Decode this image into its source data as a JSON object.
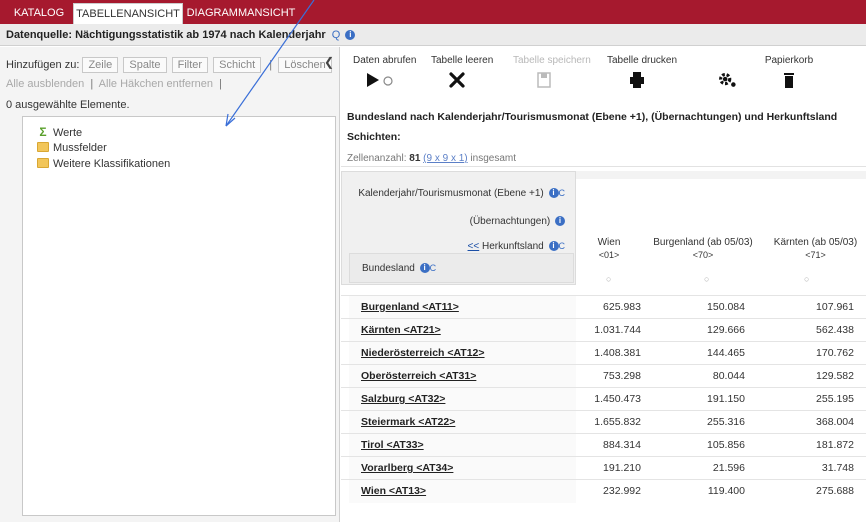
{
  "tabs": [
    {
      "label": "KATALOG"
    },
    {
      "label": "TABELLENANSICHT"
    },
    {
      "label": "DIAGRAMMANSICHT"
    }
  ],
  "source": {
    "text": "Datenquelle: Nächtigungsstatistik ab 1974 nach Kalenderjahr",
    "q_label": "Q"
  },
  "left": {
    "add_label": "Hinzufügen zu:",
    "add_buttons": [
      "Zeile",
      "Spalte",
      "Filter",
      "Schicht"
    ],
    "delete_label": "Löschen",
    "hide_all": "Alle ausblenden",
    "remove_checks": "Alle Häkchen entfernen",
    "selected_count": "0 ausgewählte Elemente.",
    "tree": [
      "Werte",
      "Mussfelder",
      "Weitere Klassifikationen"
    ]
  },
  "toolbar": {
    "fetch": "Daten abrufen",
    "clear": "Tabelle leeren",
    "save": "Tabelle speichern",
    "print": "Tabelle drucken",
    "trash": "Papierkorb"
  },
  "table": {
    "title": "Bundesland nach Kalenderjahr/Tourismusmonat (Ebene +1), (Übernachtungen) und Herkunftsland",
    "layers_label": "Schichten:",
    "cellcount_prefix": "Zellenanzahl:",
    "cellcount_value": "81",
    "cellcount_formula": "(9 x 9 x 1)",
    "cellcount_suffix": "insgesamt",
    "hdr_kalender": "Kalenderjahr/Tourismusmonat (Ebene +1)",
    "hdr_uebernachtungen": "(Übernachtungen)",
    "hdr_herkunft_prefix": "<<",
    "hdr_herkunft": "Herkunftsland",
    "hdr_bundesland": "Bundesland",
    "columns": [
      {
        "name": "Wien",
        "code": "<01>"
      },
      {
        "name": "Burgenland (ab 05/03)",
        "code": "<70>"
      },
      {
        "name": "Kärnten (ab 05/03)",
        "code": "<71>"
      }
    ],
    "rows": [
      {
        "name": "Burgenland <AT11>",
        "v": [
          "625.983",
          "150.084",
          "107.961"
        ]
      },
      {
        "name": "Kärnten <AT21>",
        "v": [
          "1.031.744",
          "129.666",
          "562.438"
        ]
      },
      {
        "name": "Niederösterreich <AT12>",
        "v": [
          "1.408.381",
          "144.465",
          "170.762"
        ]
      },
      {
        "name": "Oberösterreich <AT31>",
        "v": [
          "753.298",
          "80.044",
          "129.582"
        ]
      },
      {
        "name": "Salzburg <AT32>",
        "v": [
          "1.450.473",
          "191.150",
          "255.195"
        ]
      },
      {
        "name": "Steiermark <AT22>",
        "v": [
          "1.655.832",
          "255.316",
          "368.004"
        ]
      },
      {
        "name": "Tirol <AT33>",
        "v": [
          "884.314",
          "105.856",
          "181.872"
        ]
      },
      {
        "name": "Vorarlberg <AT34>",
        "v": [
          "191.210",
          "21.596",
          "31.748"
        ]
      },
      {
        "name": "Wien <AT13>",
        "v": [
          "232.992",
          "119.400",
          "275.688"
        ]
      }
    ]
  },
  "colors": {
    "brand": "#a6192e",
    "link": "#3b6fc4",
    "annotation": "#3a6fd8"
  }
}
